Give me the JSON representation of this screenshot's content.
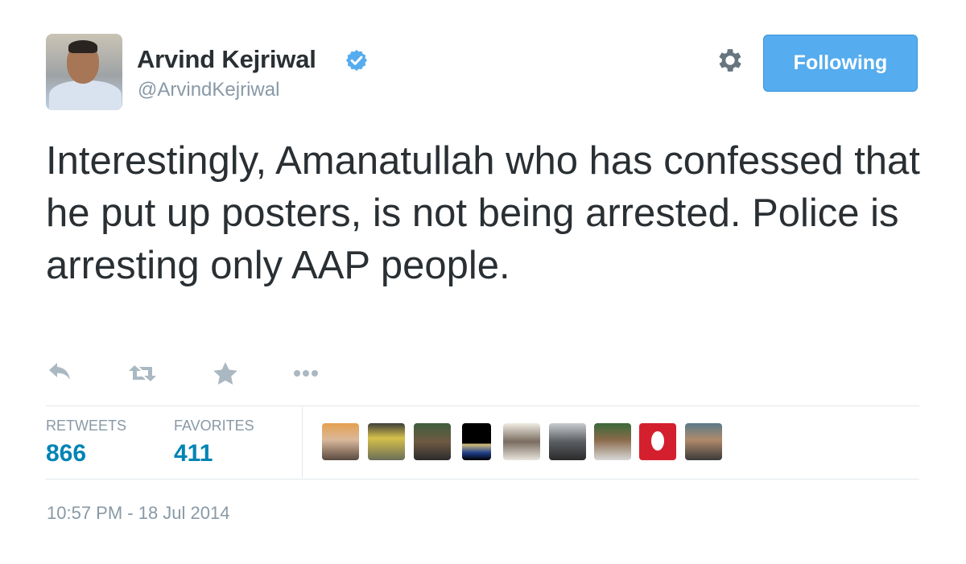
{
  "user": {
    "display_name": "Arvind Kejriwal",
    "handle": "@ArvindKejriwal",
    "verified": true
  },
  "follow_button": {
    "label": "Following"
  },
  "tweet": {
    "text": "Interestingly, Amanatullah who has confessed that he put up posters, is not being arrested. Police is arresting only AAP people."
  },
  "actions": [
    {
      "name": "reply",
      "icon": "reply-icon"
    },
    {
      "name": "retweet",
      "icon": "retweet-icon"
    },
    {
      "name": "favorite",
      "icon": "star-icon"
    },
    {
      "name": "more",
      "icon": "more-icon"
    }
  ],
  "stats": {
    "retweets_label": "RETWEETS",
    "retweets_value": "866",
    "favorites_label": "FAVORITES",
    "favorites_value": "411"
  },
  "favoriters_count_shown": 9,
  "timestamp": "10:57 PM - 18 Jul 2014",
  "colors": {
    "text": "#292f33",
    "muted": "#8899a6",
    "accent": "#55acee",
    "stat_value": "#0084b4",
    "divider": "#e1e8ed"
  }
}
